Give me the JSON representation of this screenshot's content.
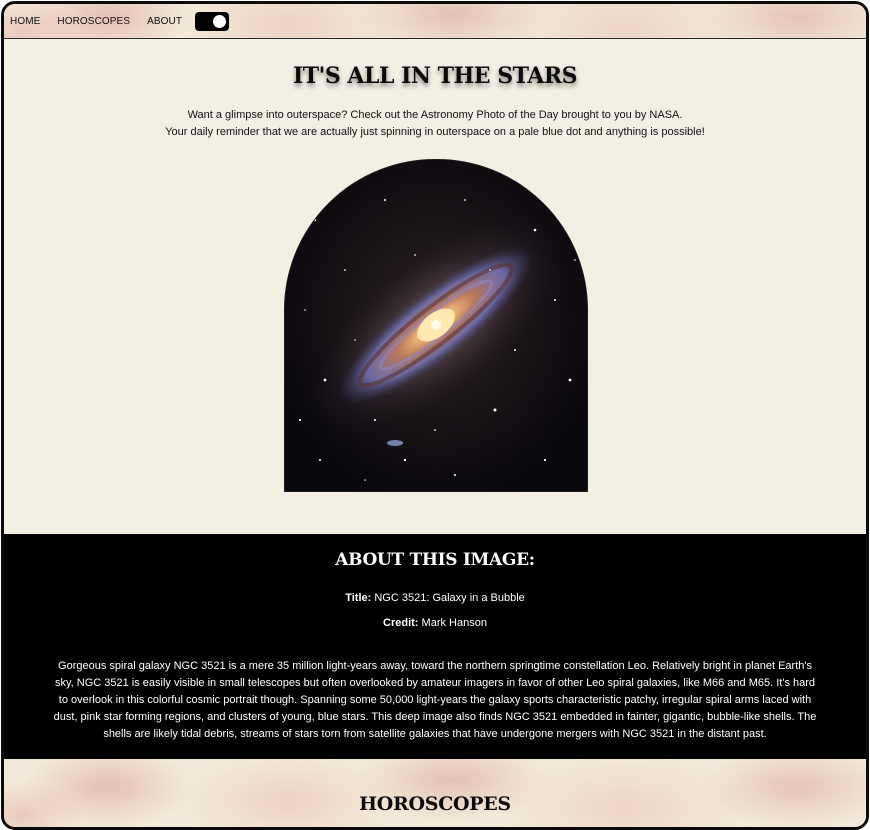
{
  "nav": {
    "items": [
      {
        "label": "HOME"
      },
      {
        "label": "HOROSCOPES"
      },
      {
        "label": "ABOUT"
      }
    ],
    "theme_toggle": {
      "state": "on"
    }
  },
  "hero": {
    "title": "IT'S ALL IN THE STARS",
    "line1": "Want a glimpse into outerspace? Check out the Astronomy Photo of the Day brought to you by NASA.",
    "line2": "Your daily reminder that we are actually just spinning in outerspace on a pale blue dot and anything is possible!"
  },
  "about": {
    "title": "ABOUT THIS IMAGE:",
    "title_label": "Title:",
    "title_value": "NGC 3521: Galaxy in a Bubble",
    "credit_label": "Credit:",
    "credit_value": "Mark Hanson",
    "description": "Gorgeous spiral galaxy NGC 3521 is a mere 35 million light-years away, toward the northern springtime constellation Leo. Relatively bright in planet Earth's sky, NGC 3521 is easily visible in small telescopes but often overlooked by amateur imagers in favor of other Leo spiral galaxies, like M66 and M65. It's hard to overlook in this colorful cosmic portrait though. Spanning some 50,000 light-years the galaxy sports characteristic patchy, irregular spiral arms laced with dust, pink star forming regions, and clusters of young, blue stars. This deep image also finds NGC 3521 embedded in fainter, gigantic, bubble-like shells. The shells are likely tidal debris, streams of stars torn from satellite galaxies that have undergone mergers with NGC 3521 in the distant past."
  },
  "horoscopes": {
    "title": "HOROSCOPES"
  },
  "colors": {
    "hero_bg": "#f3efe3",
    "about_bg": "#000000",
    "frame_border": "#0b0b0b"
  }
}
